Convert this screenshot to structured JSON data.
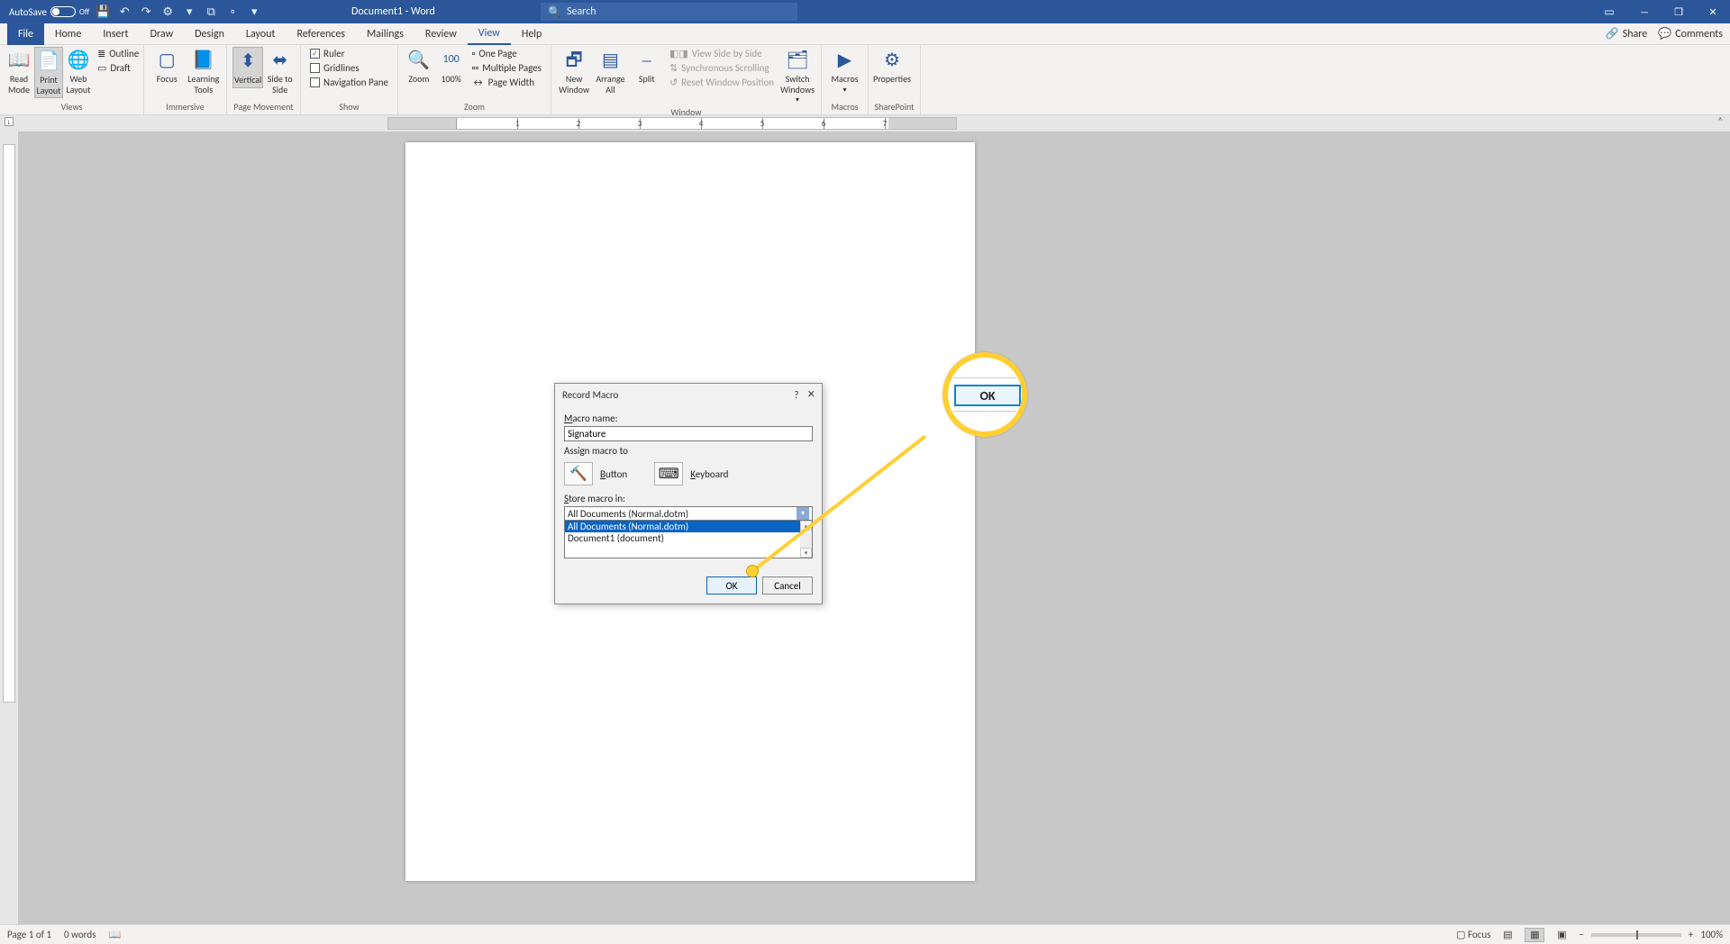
{
  "titlebar": {
    "autosave_label": "AutoSave",
    "autosave_state": "Off",
    "doc_title": "Document1 - Word",
    "search_placeholder": "Search"
  },
  "tabs": {
    "file": "File",
    "items": [
      "Home",
      "Insert",
      "Draw",
      "Design",
      "Layout",
      "References",
      "Mailings",
      "Review",
      "View",
      "Help"
    ],
    "active": "View",
    "share": "Share",
    "comments": "Comments"
  },
  "ribbon": {
    "views": {
      "title": "Views",
      "read": "Read Mode",
      "print": "Print Layout",
      "web": "Web Layout",
      "outline": "Outline",
      "draft": "Draft"
    },
    "immersive": {
      "title": "Immersive",
      "focus": "Focus",
      "learning": "Learning Tools"
    },
    "page_movement": {
      "title": "Page Movement",
      "vertical": "Vertical",
      "side": "Side to Side"
    },
    "show": {
      "title": "Show",
      "ruler": "Ruler",
      "gridlines": "Gridlines",
      "nav": "Navigation Pane"
    },
    "zoom": {
      "title": "Zoom",
      "zoom": "Zoom",
      "hundred": "100%",
      "one": "One Page",
      "multi": "Multiple Pages",
      "width": "Page Width"
    },
    "window": {
      "title": "Window",
      "new": "New Window",
      "arrange": "Arrange All",
      "split": "Split",
      "side": "View Side by Side",
      "sync": "Synchronous Scrolling",
      "reset": "Reset Window Position",
      "switch": "Switch Windows"
    },
    "macros": {
      "title": "Macros",
      "macros": "Macros"
    },
    "sharepoint": {
      "title": "SharePoint",
      "props": "Properties"
    }
  },
  "dialog": {
    "title": "Record Macro",
    "macro_name_label": "Macro name:",
    "macro_name_value": "Signature",
    "assign_label": "Assign macro to",
    "button_label": "Button",
    "keyboard_label": "Keyboard",
    "store_label": "Store macro in:",
    "store_value": "All Documents (Normal.dotm)",
    "options": [
      "All Documents (Normal.dotm)",
      "Document1 (document)"
    ],
    "ok": "OK",
    "cancel": "Cancel",
    "help": "?",
    "close": "×"
  },
  "callout": {
    "ok": "OK"
  },
  "statusbar": {
    "page": "Page 1 of 1",
    "words": "0 words",
    "focus": "Focus",
    "zoom": "100%"
  },
  "ruler": {
    "labels": [
      "1",
      "2",
      "3",
      "4",
      "5",
      "6",
      "7"
    ]
  }
}
